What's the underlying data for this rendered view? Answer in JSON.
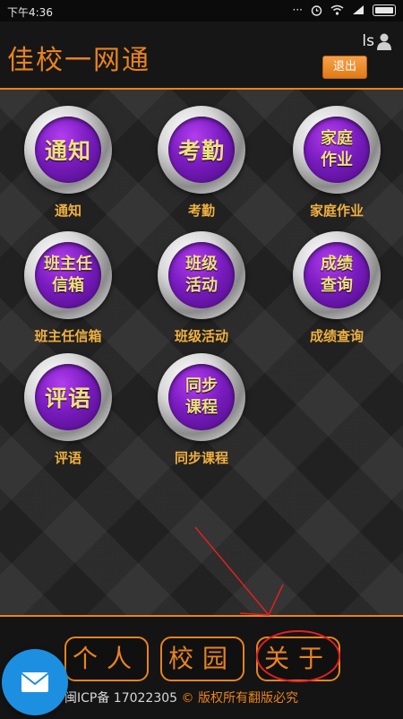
{
  "status_bar": {
    "time": "下午4:36"
  },
  "header": {
    "title": "佳校一网通",
    "user_name": "ls",
    "logout_label": "退出"
  },
  "tiles": [
    {
      "label": "通知",
      "icon_lines": [
        "通知"
      ]
    },
    {
      "label": "考勤",
      "icon_lines": [
        "考勤"
      ]
    },
    {
      "label": "家庭作业",
      "icon_lines": [
        "家庭",
        "作业"
      ]
    },
    {
      "label": "班主任信箱",
      "icon_lines": [
        "班主任",
        "信箱"
      ]
    },
    {
      "label": "班级活动",
      "icon_lines": [
        "班级",
        "活动"
      ]
    },
    {
      "label": "成绩查询",
      "icon_lines": [
        "成绩",
        "查询"
      ]
    },
    {
      "label": "评语",
      "icon_lines": [
        "评语"
      ]
    },
    {
      "label": "同步课程",
      "icon_lines": [
        "同步",
        "课程"
      ]
    }
  ],
  "bottom_nav": {
    "personal": "个人",
    "campus": "校园",
    "about": "关于"
  },
  "footer": {
    "icp": "闽ICP备 17022305",
    "copyright": "© 版权所有翻版必究"
  },
  "colors": {
    "accent": "#e8831f",
    "tile_purple": "#7a1cc0",
    "tile_text": "#f0e080",
    "annotation_red": "#e02020"
  }
}
